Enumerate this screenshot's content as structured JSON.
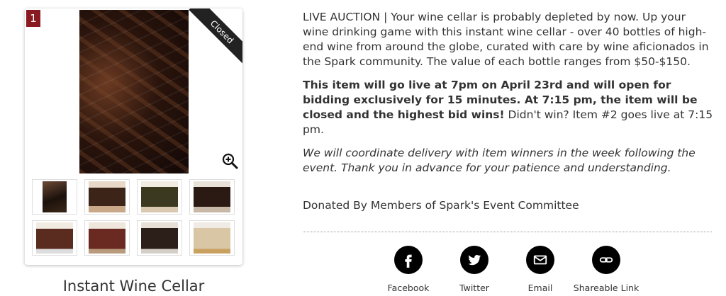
{
  "item": {
    "number": "1",
    "status": "Closed",
    "title": "Instant Wine Cellar"
  },
  "description": {
    "intro": "LIVE AUCTION | Your wine cellar is probably depleted by now. Up your wine drinking game with this instant wine cellar - over 40 bottles of high-end wine from around the globe, curated with care by wine aficionados in the Spark community. The value of each bottle ranges from $50-$150.",
    "bold": "This item will go live at 7pm on April 23rd and will open for bidding exclusively for 15 minutes. At 7:15 pm, the item will be closed and the highest bid wins!",
    "after_bold": " Didn't win? Item #2 goes live at 7:15 pm.",
    "italic": "We will coordinate delivery with item winners in the week following the event. Thank you in advance for your patience and understanding.",
    "donated": "Donated By Members of Spark's Event Committee"
  },
  "share": {
    "facebook": "Facebook",
    "twitter": "Twitter",
    "email": "Email",
    "link": "Shareable Link"
  },
  "icons": [
    "zoom-in-icon",
    "facebook-icon",
    "twitter-icon",
    "email-icon",
    "link-icon"
  ],
  "colors": {
    "badge": "#8a1a22",
    "ribbon": "#222222",
    "share_circle": "#000000"
  }
}
